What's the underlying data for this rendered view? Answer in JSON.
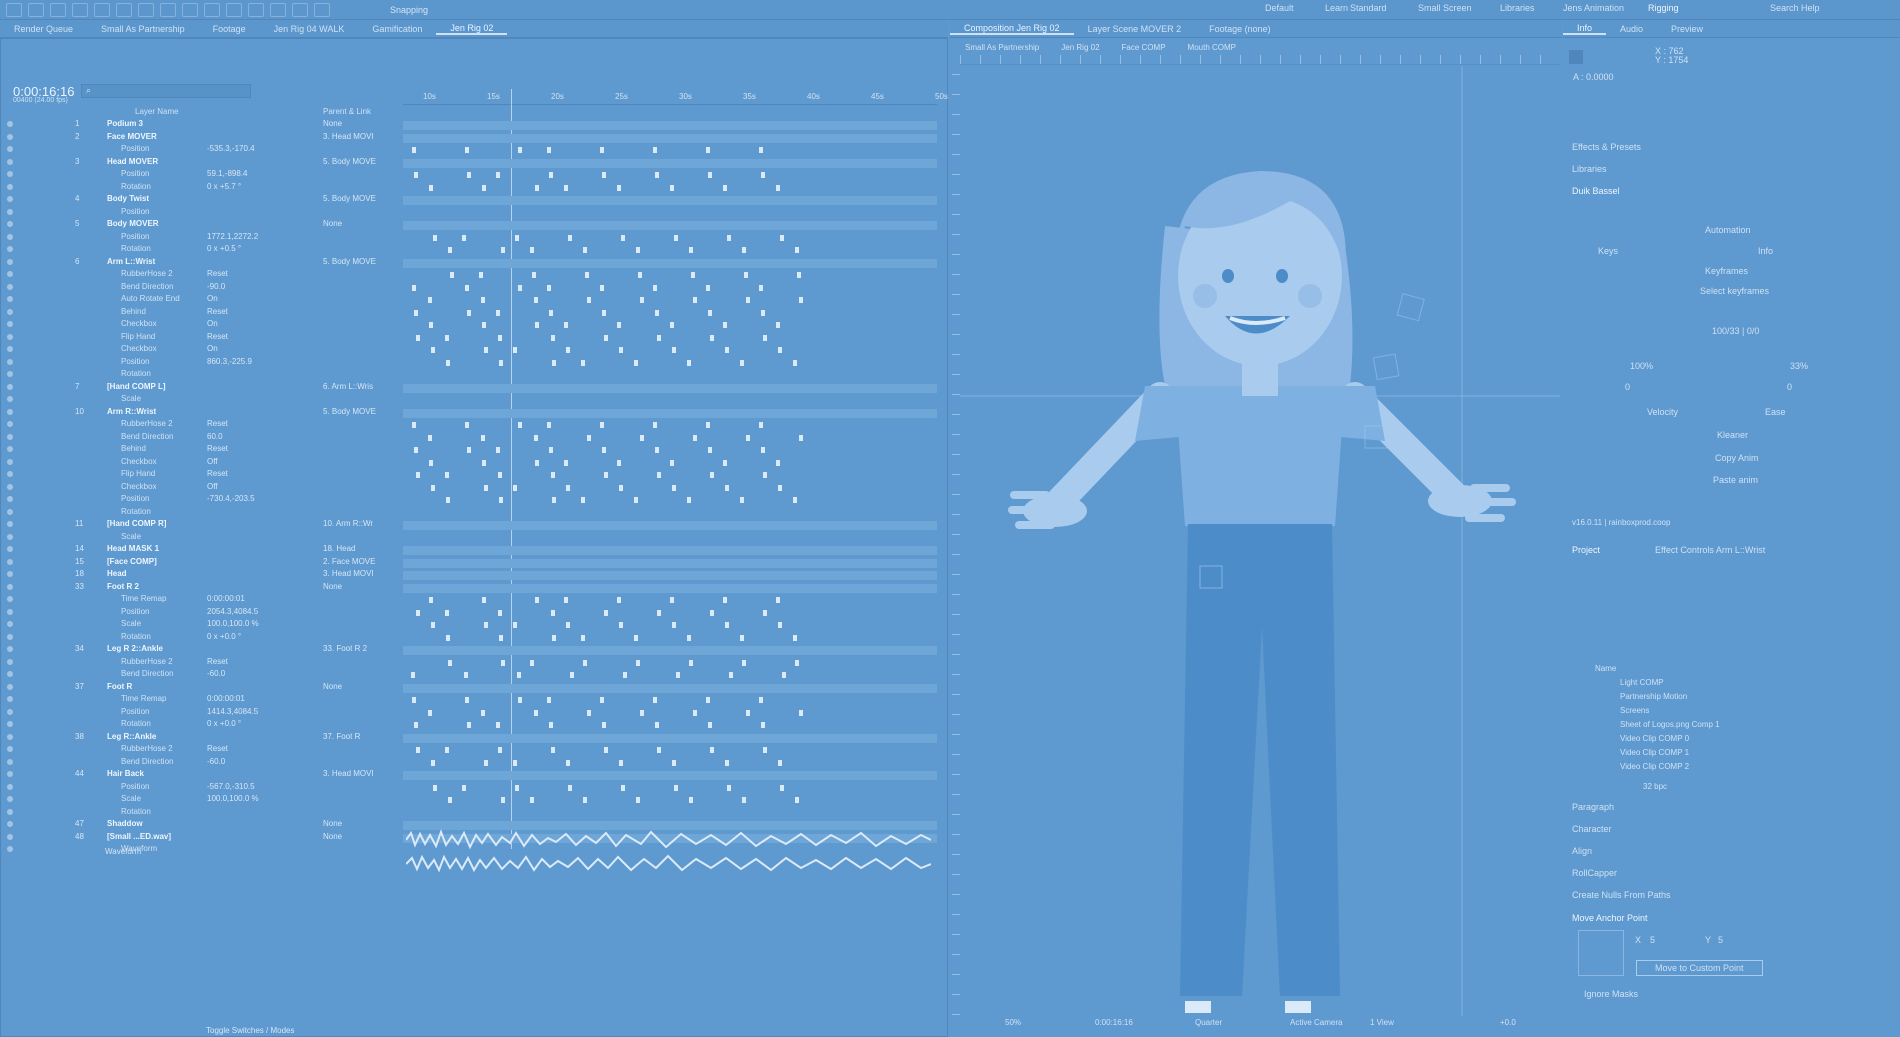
{
  "workspaces": {
    "items": [
      "Default",
      "Learn",
      "Standard",
      "Small Screen",
      "Libraries",
      "Jens Animation",
      "Rigging"
    ],
    "active": "Rigging",
    "search": "Search Help",
    "snapping": "Snapping"
  },
  "timeline": {
    "tabs": [
      "Render Queue",
      "Small As Partnership",
      "Footage",
      "Jen Rig 04 WALK",
      "Gamification",
      "Jen Rig 02"
    ],
    "active_tab": "Jen Rig 02",
    "timecode": "0:00:16:16",
    "fps": "00400 (24.00 fps)",
    "col_layer_name": "Layer Name",
    "col_parent": "Parent & Link",
    "ruler": [
      "10s",
      "15s",
      "20s",
      "25s",
      "30s",
      "35s",
      "40s",
      "45s",
      "50s"
    ],
    "toggle": "Toggle Switches / Modes",
    "rows": [
      {
        "t": "layer",
        "num": "1",
        "name": "Podium 3",
        "parent": "None"
      },
      {
        "t": "layer",
        "num": "2",
        "name": "Face MOVER",
        "parent": "3. Head MOVI"
      },
      {
        "t": "prop",
        "name": "Position",
        "val": "-535.3,-170.4"
      },
      {
        "t": "layer",
        "num": "3",
        "name": "Head MOVER",
        "parent": "5. Body MOVE"
      },
      {
        "t": "prop",
        "name": "Position",
        "val": "59.1,-898.4"
      },
      {
        "t": "prop",
        "name": "Rotation",
        "val": "0 x +5.7 °"
      },
      {
        "t": "layer",
        "num": "4",
        "name": "Body Twist",
        "parent": "5. Body MOVE"
      },
      {
        "t": "prop",
        "name": "Position",
        "val": ""
      },
      {
        "t": "layer",
        "num": "5",
        "name": "Body MOVER",
        "parent": "None"
      },
      {
        "t": "prop",
        "name": "Position",
        "val": "1772.1,2272.2"
      },
      {
        "t": "prop",
        "name": "Rotation",
        "val": "0 x +0.5 °"
      },
      {
        "t": "layer",
        "num": "6",
        "name": "Arm L::Wrist",
        "parent": "5. Body MOVE"
      },
      {
        "t": "fx",
        "name": "RubberHose 2",
        "val": "Reset"
      },
      {
        "t": "prop",
        "name": "Bend Direction",
        "val": "-90.0"
      },
      {
        "t": "prop",
        "name": "Auto Rotate End",
        "val": "On"
      },
      {
        "t": "fx",
        "name": "Behind",
        "val": "Reset"
      },
      {
        "t": "prop",
        "name": "Checkbox",
        "val": "On"
      },
      {
        "t": "fx",
        "name": "Flip Hand",
        "val": "Reset"
      },
      {
        "t": "prop",
        "name": "Checkbox",
        "val": "On"
      },
      {
        "t": "prop",
        "name": "Position",
        "val": "860.3,-225.9"
      },
      {
        "t": "prop",
        "name": "Rotation",
        "val": ""
      },
      {
        "t": "layer",
        "num": "7",
        "name": "[Hand COMP L]",
        "parent": "6. Arm L::Wris"
      },
      {
        "t": "prop",
        "name": "Scale",
        "val": ""
      },
      {
        "t": "layer",
        "num": "10",
        "name": "Arm R::Wrist",
        "parent": "5. Body MOVE"
      },
      {
        "t": "fx",
        "name": "RubberHose 2",
        "val": "Reset"
      },
      {
        "t": "prop",
        "name": "Bend Direction",
        "val": "60.0"
      },
      {
        "t": "fx",
        "name": "Behind",
        "val": "Reset"
      },
      {
        "t": "prop",
        "name": "Checkbox",
        "val": "Off"
      },
      {
        "t": "fx",
        "name": "Flip Hand",
        "val": "Reset"
      },
      {
        "t": "prop",
        "name": "Checkbox",
        "val": "Off"
      },
      {
        "t": "prop",
        "name": "Position",
        "val": "-730.4,-203.5"
      },
      {
        "t": "prop",
        "name": "Rotation",
        "val": ""
      },
      {
        "t": "layer",
        "num": "11",
        "name": "[Hand COMP R]",
        "parent": "10. Arm R::Wr"
      },
      {
        "t": "prop",
        "name": "Scale",
        "val": ""
      },
      {
        "t": "layer",
        "num": "14",
        "name": "Head MASK 1",
        "parent": "18. Head"
      },
      {
        "t": "layer",
        "num": "15",
        "name": "[Face COMP]",
        "parent": "2. Face MOVE"
      },
      {
        "t": "layer",
        "num": "18",
        "name": "Head",
        "parent": "3. Head MOVI"
      },
      {
        "t": "layer",
        "num": "33",
        "name": "Foot R 2",
        "parent": "None"
      },
      {
        "t": "prop",
        "name": "Time Remap",
        "val": "0:00:00:01"
      },
      {
        "t": "prop",
        "name": "Position",
        "val": "2054.3,4084.5"
      },
      {
        "t": "prop",
        "name": "Scale",
        "val": "100.0,100.0 %"
      },
      {
        "t": "prop",
        "name": "Rotation",
        "val": "0 x +0.0 °"
      },
      {
        "t": "layer",
        "num": "34",
        "name": "Leg R 2::Ankle",
        "parent": "33. Foot R 2"
      },
      {
        "t": "fx",
        "name": "RubberHose 2",
        "val": "Reset"
      },
      {
        "t": "prop",
        "name": "Bend Direction",
        "val": "-60.0"
      },
      {
        "t": "layer",
        "num": "37",
        "name": "Foot R",
        "parent": "None"
      },
      {
        "t": "prop",
        "name": "Time Remap",
        "val": "0:00:00:01"
      },
      {
        "t": "prop",
        "name": "Position",
        "val": "1414.3,4084.5"
      },
      {
        "t": "prop",
        "name": "Rotation",
        "val": "0 x +0.0 °"
      },
      {
        "t": "layer",
        "num": "38",
        "name": "Leg R::Ankle",
        "parent": "37. Foot R"
      },
      {
        "t": "fx",
        "name": "RubberHose 2",
        "val": "Reset"
      },
      {
        "t": "prop",
        "name": "Bend Direction",
        "val": "-60.0"
      },
      {
        "t": "layer",
        "num": "44",
        "name": "Hair Back",
        "parent": "3. Head MOVI"
      },
      {
        "t": "prop",
        "name": "Position",
        "val": "-567.0,-310.5"
      },
      {
        "t": "prop",
        "name": "Scale",
        "val": "100.0,100.0 %"
      },
      {
        "t": "prop",
        "name": "Rotation",
        "val": ""
      },
      {
        "t": "layer",
        "num": "47",
        "name": "Shaddow",
        "parent": "None"
      },
      {
        "t": "layer",
        "num": "48",
        "name": "[Small ...ED.wav]",
        "parent": "None"
      },
      {
        "t": "prop",
        "name": "Waveform",
        "val": ""
      }
    ],
    "waveform_label": "Waveform"
  },
  "composition": {
    "tabs": [
      "Composition Jen Rig 02",
      "Layer Scene MOVER 2",
      "Footage (none)"
    ],
    "breadcrumbs": [
      "Small As Partnership",
      "Jen Rig 02",
      "Face COMP",
      "Mouth COMP"
    ],
    "zoom": "50%",
    "timecode": "0:00:16:16",
    "resolution": "Quarter",
    "camera": "Active Camera",
    "view": "1 View",
    "exposure": "+0.0"
  },
  "info": {
    "tabs": [
      "Info",
      "Audio",
      "Preview"
    ],
    "x": "X : 762",
    "y": "Y : 1754",
    "a": "A : 0.0000"
  },
  "right": {
    "effects": "Effects & Presets",
    "libraries": "Libraries",
    "duik": "Duik Bassel",
    "automation": "Automation",
    "keys": "Keys",
    "info_label": "Info",
    "keyframes": "Keyframes",
    "select_kf": "Select keyframes",
    "frames": "100/33 | 0/0",
    "p100": "100%",
    "p33": "33%",
    "zero1": "0",
    "zero2": "0",
    "velocity": "Velocity",
    "ease": "Ease",
    "kleaner": "Kleaner",
    "copy": "Copy Anim",
    "paste": "Paste anim",
    "version": "v16.0.11 | rainboxprod.coop",
    "project": "Project",
    "effect_controls": "Effect Controls Arm L::Wrist",
    "name_col": "Name",
    "items": [
      "Light COMP",
      "Partnership Motion",
      "Screens",
      "Sheet of Logos.png Comp 1",
      "Video Clip COMP 0",
      "Video Clip COMP 1",
      "Video Clip COMP 2"
    ],
    "bpc": "32 bpc",
    "paragraph": "Paragraph",
    "character": "Character",
    "align": "Align",
    "rollcapper": "RollCapper",
    "nulls": "Create Nulls From Paths",
    "anchor": "Move Anchor Point",
    "ax": "X",
    "ay": "Y",
    "avx": "5",
    "avy": "5",
    "custom": "Move to Custom Point",
    "ignore": "Ignore Masks"
  },
  "colors": {
    "bg": "#5e99cf",
    "char_skin": "#a8cbee",
    "char_hair": "#8cb6e3",
    "char_shirt": "#7fb0e2",
    "char_pants": "#4c8cc9"
  }
}
